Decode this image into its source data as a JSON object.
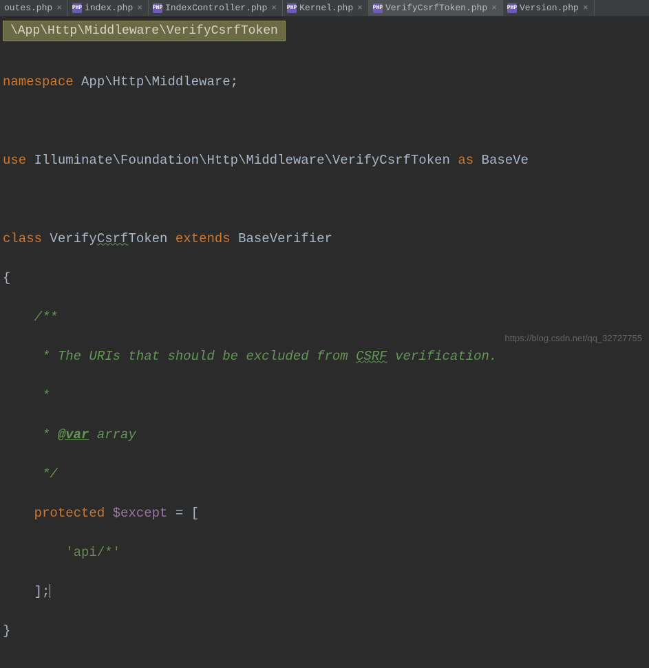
{
  "tabs": [
    {
      "label": "outes.php",
      "partial": true
    },
    {
      "label": "index.php"
    },
    {
      "label": "IndexController.php"
    },
    {
      "label": "Kernel.php"
    },
    {
      "label": "VerifyCsrfToken.php",
      "active": true
    },
    {
      "label": "Version.php"
    }
  ],
  "tab_close_glyph": "×",
  "tab_icon_text": "PHP",
  "breadcrumb": "\\App\\Http\\Middleware\\VerifyCsrfToken",
  "code": {
    "namespace_kw": "namespace",
    "namespace_val": " App\\Http\\Middleware",
    "namespace_semi": ";",
    "use_kw": "use",
    "use_path": " Illuminate\\Foundation\\Http\\Middleware\\VerifyCsrfToken ",
    "as_kw": "as",
    "use_alias": " BaseVe",
    "class_kw": "class",
    "class_name": " VerifyCsrfToken ",
    "class_name_u": "Csrf",
    "class_name_a": " Verify",
    "class_name_b": "Token ",
    "extends_kw": "extends",
    "base_class": " BaseVerifier",
    "brace_open": "{",
    "brace_close": "}",
    "doc_open": "    /**",
    "doc_line1": "     * The URIs that should be excluded from ",
    "doc_line1_u": "CSRF",
    "doc_line1_after": " verification.",
    "doc_star": "     *",
    "doc_var_pre": "     * ",
    "doc_var_tag": "@var",
    "doc_var_type": " array",
    "doc_close": "     */",
    "protected_kw": "    protected ",
    "except_var": "$except",
    "equals_bracket": " = [",
    "string_val": "        'api/*'",
    "close_arr": "    ];"
  },
  "watermark": "https://blog.csdn.net/qq_32727755"
}
